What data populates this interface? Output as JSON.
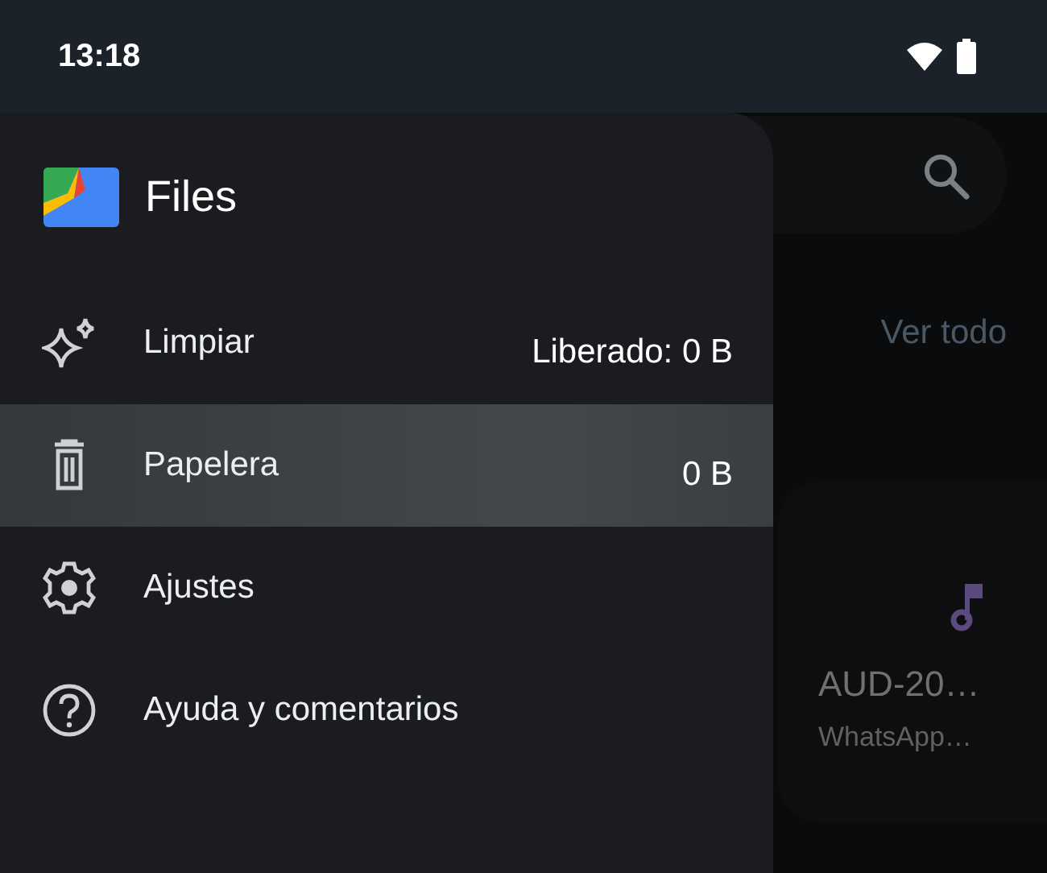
{
  "status_bar": {
    "time": "13:18"
  },
  "drawer": {
    "app_title": "Files",
    "items": [
      {
        "kind": "sparkle",
        "label": "Limpiar",
        "value": "Liberado: 0 B",
        "selected": false
      },
      {
        "kind": "trash",
        "label": "Papelera",
        "value": "0 B",
        "selected": true
      },
      {
        "kind": "gear",
        "label": "Ajustes",
        "selected": false
      },
      {
        "kind": "help",
        "label": "Ayuda y comentarios",
        "selected": false
      }
    ]
  },
  "background": {
    "link": "Ver todo",
    "card": {
      "title": "AUD-20…",
      "subtitle": "WhatsApp…"
    }
  }
}
